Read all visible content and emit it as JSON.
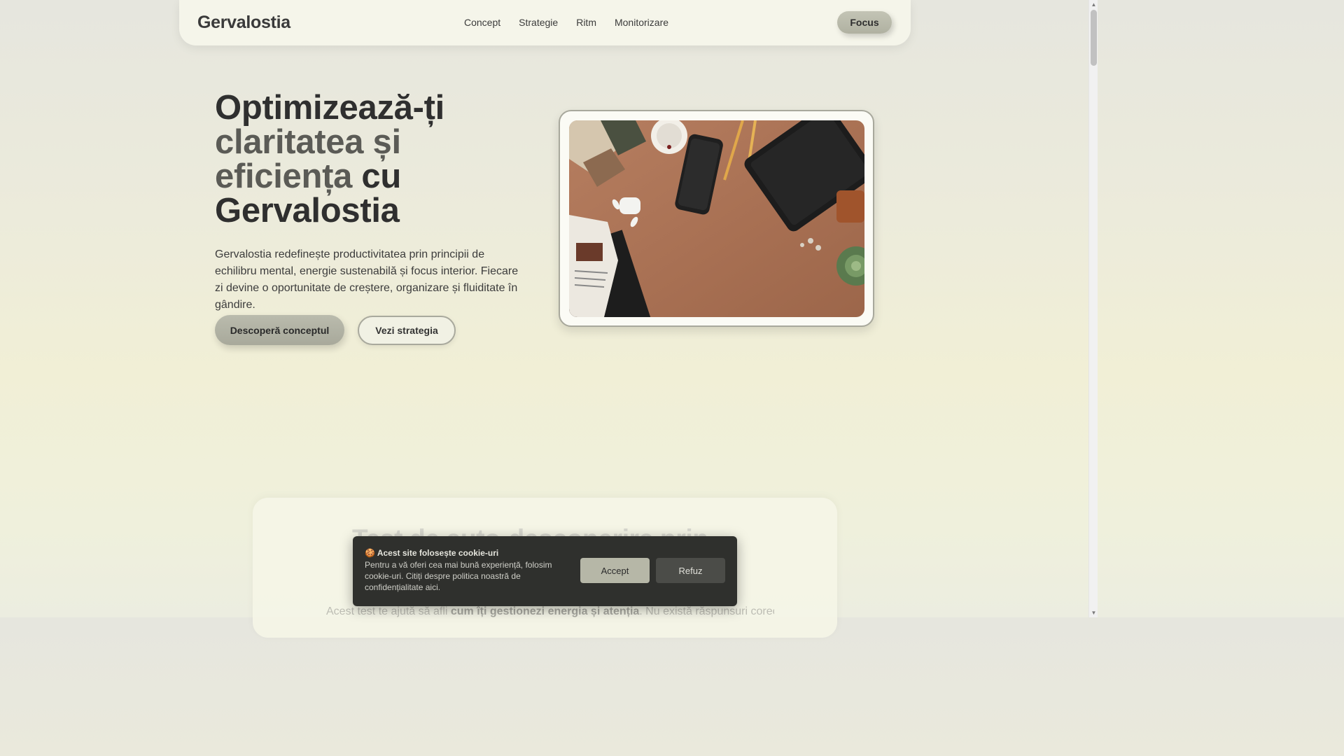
{
  "navbar": {
    "brand": "Gervalostia",
    "links": [
      "Concept",
      "Strategie",
      "Ritm",
      "Monitorizare"
    ],
    "focus_label": "Focus"
  },
  "hero": {
    "title_line1": "Optimizează-ți",
    "title_soft_line2": "claritatea și",
    "title_soft_line3": "eficiența",
    "title_plain_line3": " cu",
    "title_line4": "Gervalostia",
    "description": "Gervalostia redefinește productivitatea prin principii de echilibru mental, energie sustenabilă și focus interior. Fiecare zi devine o oportunitate de creștere, organizare și fluiditate în gândire.",
    "primary_button": "Descoperă conceptul",
    "secondary_button": "Vezi strategia",
    "image_description_icon": "desk-flatlay-image"
  },
  "test_section": {
    "title": "Test de auto-descoperire prin",
    "desc_before": "Acest test te ajută să afli ",
    "desc_strong": "cum îți gestionezi energia și atenția",
    "desc_after": ". Nu există răspunsuri corecte —"
  },
  "cookie": {
    "title": "🍪 Acest site folosește cookie-uri",
    "text": "Pentru a vă oferi cea mai bună experiență, folosim cookie-uri. Citiți despre politica noastră de confidențialitate aici.",
    "accept": "Accept",
    "refuse": "Refuz"
  },
  "colors": {
    "accent_button": "#b0b1a1",
    "cookie_bg": "#2f302d",
    "text_dark": "#2f2f2f"
  }
}
